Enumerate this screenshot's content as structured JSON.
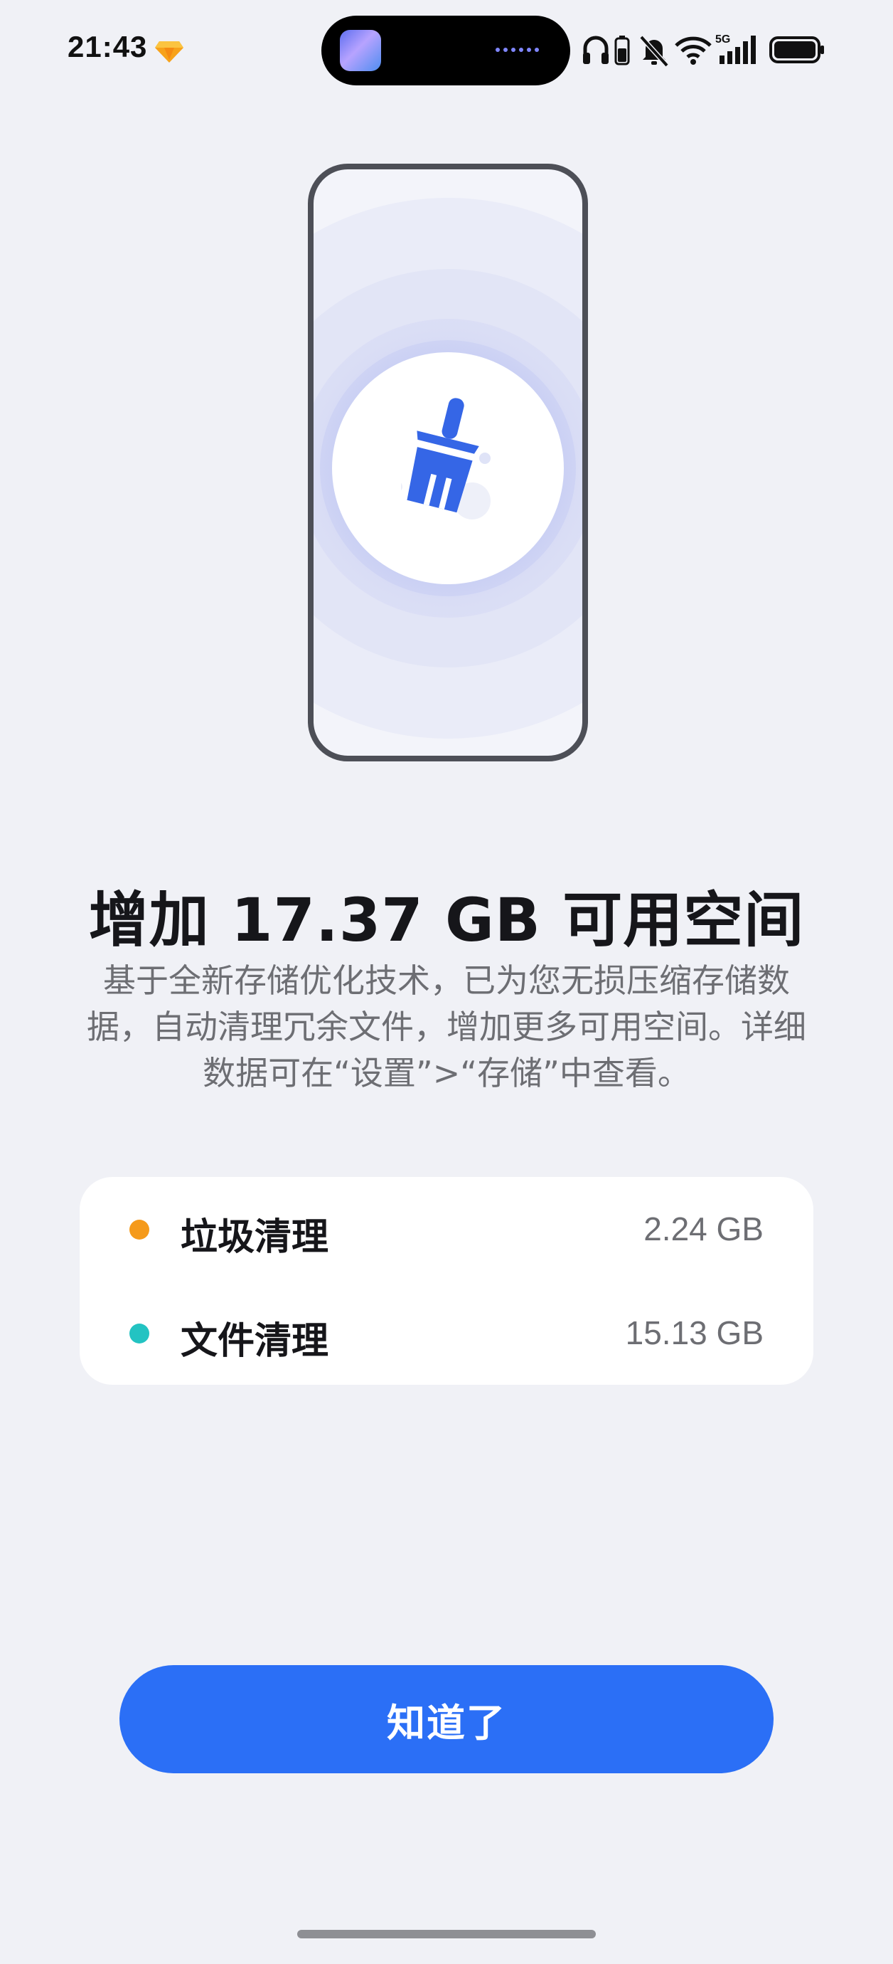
{
  "status_bar": {
    "time": "21:43",
    "icons": [
      "gem-icon",
      "headphones-icon",
      "battery-small-icon",
      "bell-muted-icon",
      "wifi-icon",
      "5g-signal-icon",
      "battery-icon"
    ],
    "network_label": "5G"
  },
  "dynamic_island": {
    "app_icon": "gallery-app-icon",
    "indicator": "dots-indicator"
  },
  "illustration": {
    "icon": "broom-icon",
    "accent_color": "#3566e6"
  },
  "headline": "增加 17.37 GB 可用空间",
  "description": "基于全新存储优化技术，已为您无损压缩存储数据，自动清理冗余文件，增加更多可用空间。详细数据可在“设置”>“存储”中查看。",
  "summary": {
    "items": [
      {
        "label": "垃圾清理",
        "value": "2.24 GB",
        "color": "#f59a1b"
      },
      {
        "label": "文件清理",
        "value": "15.13 GB",
        "color": "#23c3c2"
      }
    ]
  },
  "button": {
    "label": "知道了",
    "color": "#2b6ff6"
  }
}
